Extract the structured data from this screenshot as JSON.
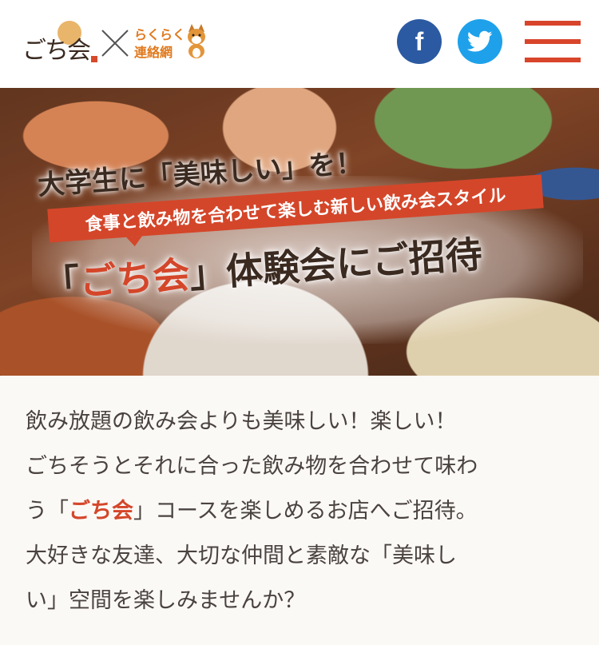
{
  "header": {
    "logo_main_text": "ごち会",
    "logo_partner_line1": "らくらく",
    "logo_partner_line2": "連絡網",
    "facebook_icon_glyph": "f",
    "colors": {
      "facebook": "#2b5aa2",
      "twitter": "#1ea1ea",
      "menu": "#d8452b"
    }
  },
  "hero": {
    "headline_line1": "大学生に「美味しい」を！",
    "ribbon_text": "食事と飲み物を合わせて楽しむ新しい飲み会スタイル",
    "headline_line2_open": "「",
    "headline_line2_brand": "ごち会",
    "headline_line2_rest": "」体験会にご招待"
  },
  "intro": {
    "line1": "飲み放題の飲み会よりも美味しい！楽しい！",
    "line2": "ごちそうとそれに合った飲み物を合わせて味わ",
    "line3_pre": "う「",
    "line3_brand": "ごち会",
    "line3_post": "」コースを楽しめるお店へご招待。",
    "line4": "大好きな友達、大切な仲間と素敵な「美味し",
    "line5": "い」空間を楽しみませんか？"
  },
  "accent_color": "#d4462a"
}
